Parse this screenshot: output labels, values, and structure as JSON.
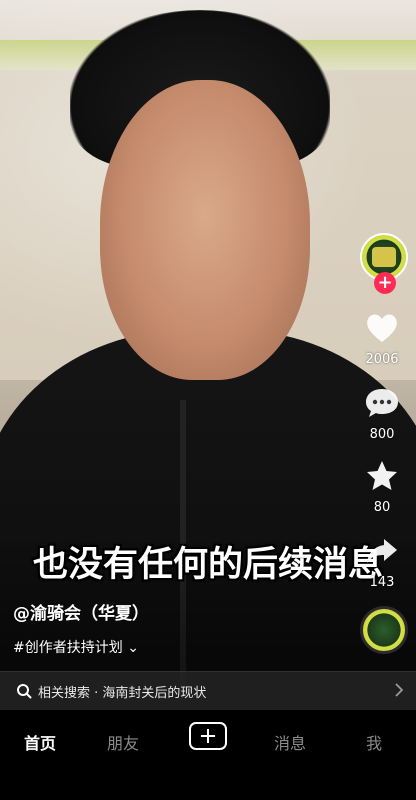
{
  "video": {
    "subtitle": "也没有任何的后续消息"
  },
  "author": {
    "handle": "@渝骑会（华夏）",
    "hashtag": "#创作者扶持计划",
    "hashtag_chevron": "⌄"
  },
  "side_actions": {
    "follow_symbol": "+",
    "like_count": "2006",
    "comment_count": "800",
    "favorite_count": "80",
    "share_count": "143"
  },
  "related_search": {
    "text": "相关搜索 · 海南封关后的现状"
  },
  "bottom_nav": {
    "home": "首页",
    "friends": "朋友",
    "messages": "消息",
    "me": "我"
  },
  "colors": {
    "follow": "#fe2c55",
    "nav_active": "#ffffff",
    "nav_inactive": "#8a8a8a"
  }
}
